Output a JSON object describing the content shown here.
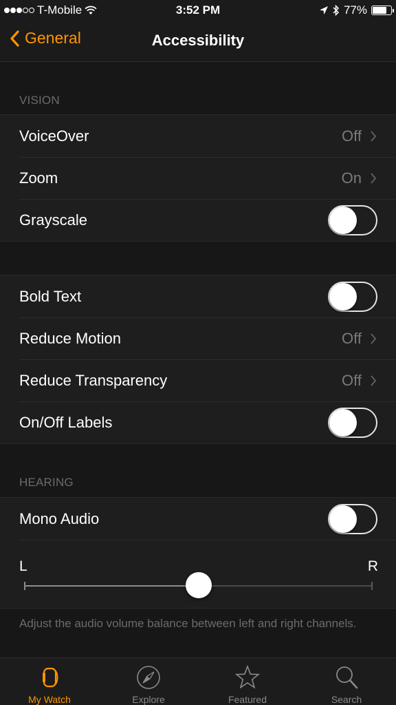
{
  "status_bar": {
    "signal_filled": 3,
    "signal_total": 5,
    "carrier": "T-Mobile",
    "time": "3:52 PM",
    "battery_percent": "77%",
    "battery_level": 0.77,
    "icons": [
      "wifi-icon",
      "location-arrow-icon",
      "bluetooth-icon",
      "battery-icon"
    ]
  },
  "nav": {
    "back_label": "General",
    "title": "Accessibility"
  },
  "sections": {
    "vision": {
      "header": "VISION",
      "rows": [
        {
          "label": "VoiceOver",
          "type": "disclosure",
          "value": "Off"
        },
        {
          "label": "Zoom",
          "type": "disclosure",
          "value": "On"
        },
        {
          "label": "Grayscale",
          "type": "toggle",
          "on": false
        }
      ]
    },
    "display": {
      "rows": [
        {
          "label": "Bold Text",
          "type": "toggle",
          "on": false
        },
        {
          "label": "Reduce Motion",
          "type": "disclosure",
          "value": "Off"
        },
        {
          "label": "Reduce Transparency",
          "type": "disclosure",
          "value": "Off"
        },
        {
          "label": "On/Off Labels",
          "type": "toggle",
          "on": false
        }
      ]
    },
    "hearing": {
      "header": "HEARING",
      "rows": [
        {
          "label": "Mono Audio",
          "type": "toggle",
          "on": false
        }
      ],
      "balance": {
        "left_label": "L",
        "right_label": "R",
        "value": 0.5
      },
      "footer": "Adjust the audio volume balance between left and right channels."
    }
  },
  "tabbar": {
    "tabs": [
      {
        "label": "My Watch",
        "icon": "watch-icon",
        "active": true
      },
      {
        "label": "Explore",
        "icon": "compass-icon",
        "active": false
      },
      {
        "label": "Featured",
        "icon": "star-icon",
        "active": false
      },
      {
        "label": "Search",
        "icon": "search-icon",
        "active": false
      }
    ]
  },
  "colors": {
    "accent": "#ff9500",
    "background": "#171717",
    "cell": "#1e1e1e",
    "secondary_text": "#7a7a7a"
  }
}
